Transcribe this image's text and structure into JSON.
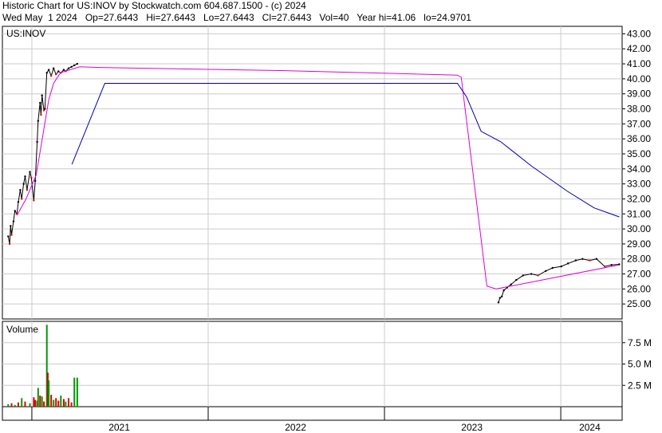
{
  "header": {
    "title": "Historic Chart for US:INOV by Stockwatch.com 604.687.1500 - (c) 2024",
    "quote_line": "Wed May  1 2024   Op=27.6443   Hi=27.6443   Lo=27.6443   Cl=27.6443   Vol=40   Year hi=41.06   lo=24.9701"
  },
  "chart_data": [
    {
      "type": "line",
      "title": "US:INOV",
      "ylim": [
        24,
        43.5
      ],
      "y_ticks": [
        "43.00",
        "42.00",
        "41.00",
        "40.00",
        "39.00",
        "38.00",
        "37.00",
        "36.00",
        "35.00",
        "34.00",
        "33.00",
        "32.00",
        "31.00",
        "30.00",
        "29.00",
        "28.00",
        "27.00",
        "26.00",
        "25.00"
      ],
      "x_labels": [
        "2021",
        "2022",
        "2023",
        "2024"
      ],
      "grid": true,
      "colors": {
        "price": "#000000",
        "ma_short": "#dd00dd",
        "ma_long": "#0000aa",
        "down_tick": "#dd0000"
      },
      "series": [
        {
          "kind": "price",
          "points": [
            [
              "2020-11-13",
              29.5
            ],
            [
              "2020-11-16",
              29.0
            ],
            [
              "2020-11-18",
              30.2
            ],
            [
              "2020-11-20",
              29.6
            ],
            [
              "2020-11-24",
              30.5
            ],
            [
              "2020-11-27",
              31.2
            ],
            [
              "2020-12-01",
              31.0
            ],
            [
              "2020-12-04",
              31.8
            ],
            [
              "2020-12-08",
              32.6
            ],
            [
              "2020-12-11",
              32.0
            ],
            [
              "2020-12-15",
              33.0
            ],
            [
              "2020-12-18",
              33.5
            ],
            [
              "2020-12-22",
              32.6
            ],
            [
              "2020-12-28",
              33.8
            ],
            [
              "2020-12-31",
              33.4
            ],
            [
              "2021-01-05",
              31.9
            ],
            [
              "2021-01-08",
              33.2
            ],
            [
              "2021-01-12",
              35.8
            ],
            [
              "2021-01-14",
              37.2
            ],
            [
              "2021-01-18",
              38.4
            ],
            [
              "2021-01-20",
              37.6
            ],
            [
              "2021-01-22",
              38.9
            ],
            [
              "2021-01-26",
              37.9
            ],
            [
              "2021-01-28",
              38.0
            ],
            [
              "2021-02-01",
              40.4
            ],
            [
              "2021-02-05",
              40.6
            ],
            [
              "2021-02-10",
              40.2
            ],
            [
              "2021-02-15",
              40.7
            ],
            [
              "2021-02-20",
              40.3
            ],
            [
              "2021-02-25",
              40.5
            ],
            [
              "2021-03-02",
              40.4
            ],
            [
              "2021-03-08",
              40.6
            ],
            [
              "2021-03-12",
              40.5
            ],
            [
              "2021-03-18",
              40.7
            ],
            [
              "2021-03-24",
              40.8
            ],
            [
              "2021-03-30",
              40.9
            ],
            [
              "2021-04-05",
              41.0
            ]
          ]
        },
        {
          "kind": "price",
          "points": [
            [
              "2023-08-25",
              25.1
            ],
            [
              "2023-08-28",
              25.4
            ],
            [
              "2023-09-01",
              25.5
            ],
            [
              "2023-09-05",
              25.9
            ],
            [
              "2023-09-12",
              26.1
            ],
            [
              "2023-09-20",
              26.3
            ],
            [
              "2023-10-01",
              26.6
            ],
            [
              "2023-10-15",
              26.9
            ],
            [
              "2023-11-01",
              27.0
            ],
            [
              "2023-11-15",
              26.9
            ],
            [
              "2023-12-01",
              27.2
            ],
            [
              "2023-12-15",
              27.4
            ],
            [
              "2024-01-02",
              27.5
            ],
            [
              "2024-01-16",
              27.7
            ],
            [
              "2024-02-01",
              27.9
            ],
            [
              "2024-02-15",
              28.0
            ],
            [
              "2024-03-01",
              27.9
            ],
            [
              "2024-03-15",
              28.0
            ],
            [
              "2024-04-01",
              27.5
            ],
            [
              "2024-04-15",
              27.6
            ],
            [
              "2024-05-01",
              27.64
            ]
          ]
        },
        {
          "kind": "ma_short",
          "points": [
            [
              "2020-12-01",
              30.9
            ],
            [
              "2020-12-20",
              32.0
            ],
            [
              "2021-01-10",
              33.6
            ],
            [
              "2021-01-20",
              35.5
            ],
            [
              "2021-02-05",
              38.6
            ],
            [
              "2021-02-15",
              39.7
            ],
            [
              "2021-03-01",
              40.4
            ],
            [
              "2021-04-10",
              40.8
            ],
            [
              "2021-06-01",
              40.75
            ],
            [
              "2022-06-01",
              40.55
            ],
            [
              "2023-06-01",
              40.25
            ],
            [
              "2023-06-09",
              40.1
            ],
            [
              "2023-08-01",
              26.2
            ],
            [
              "2023-08-20",
              26.0
            ],
            [
              "2024-05-01",
              27.6
            ]
          ]
        },
        {
          "kind": "ma_long",
          "points": [
            [
              "2021-03-25",
              34.3
            ],
            [
              "2021-06-01",
              39.7
            ],
            [
              "2023-06-01",
              39.7
            ],
            [
              "2023-06-20",
              38.8
            ],
            [
              "2023-07-20",
              36.5
            ],
            [
              "2023-08-30",
              35.8
            ],
            [
              "2023-11-01",
              34.2
            ],
            [
              "2024-01-15",
              32.5
            ],
            [
              "2024-03-10",
              31.4
            ],
            [
              "2024-05-01",
              30.8
            ]
          ]
        }
      ]
    },
    {
      "type": "bar",
      "title": "Volume",
      "ylim": [
        0,
        10000000
      ],
      "y_ticks": [
        "7.5 M",
        "5.0 M",
        "2.5 M"
      ],
      "colors": {
        "up": "#009900",
        "down": "#dd0000"
      },
      "bars": [
        [
          "2020-11-13",
          0.3,
          "up"
        ],
        [
          "2020-11-20",
          0.4,
          "down"
        ],
        [
          "2020-11-27",
          0.2,
          "up"
        ],
        [
          "2020-12-04",
          0.5,
          "down"
        ],
        [
          "2020-12-11",
          1.0,
          "up"
        ],
        [
          "2020-12-18",
          0.6,
          "down"
        ],
        [
          "2020-12-28",
          0.4,
          "up"
        ],
        [
          "2021-01-05",
          1.1,
          "down"
        ],
        [
          "2021-01-08",
          0.8,
          "down"
        ],
        [
          "2021-01-12",
          0.7,
          "up"
        ],
        [
          "2021-01-14",
          2.2,
          "up"
        ],
        [
          "2021-01-18",
          1.3,
          "down"
        ],
        [
          "2021-01-22",
          1.2,
          "up"
        ],
        [
          "2021-01-26",
          0.6,
          "down"
        ],
        [
          "2021-02-01",
          9.6,
          "up"
        ],
        [
          "2021-02-03",
          4.0,
          "down"
        ],
        [
          "2021-02-05",
          3.1,
          "up"
        ],
        [
          "2021-02-10",
          1.4,
          "down"
        ],
        [
          "2021-02-15",
          0.8,
          "up"
        ],
        [
          "2021-02-20",
          1.0,
          "down"
        ],
        [
          "2021-02-25",
          0.7,
          "down"
        ],
        [
          "2021-03-02",
          1.3,
          "up"
        ],
        [
          "2021-03-08",
          0.9,
          "down"
        ],
        [
          "2021-03-12",
          0.6,
          "up"
        ],
        [
          "2021-03-18",
          1.0,
          "down"
        ],
        [
          "2021-03-24",
          0.5,
          "down"
        ],
        [
          "2021-03-30",
          3.4,
          "up"
        ],
        [
          "2021-04-05",
          3.4,
          "up"
        ]
      ]
    }
  ]
}
